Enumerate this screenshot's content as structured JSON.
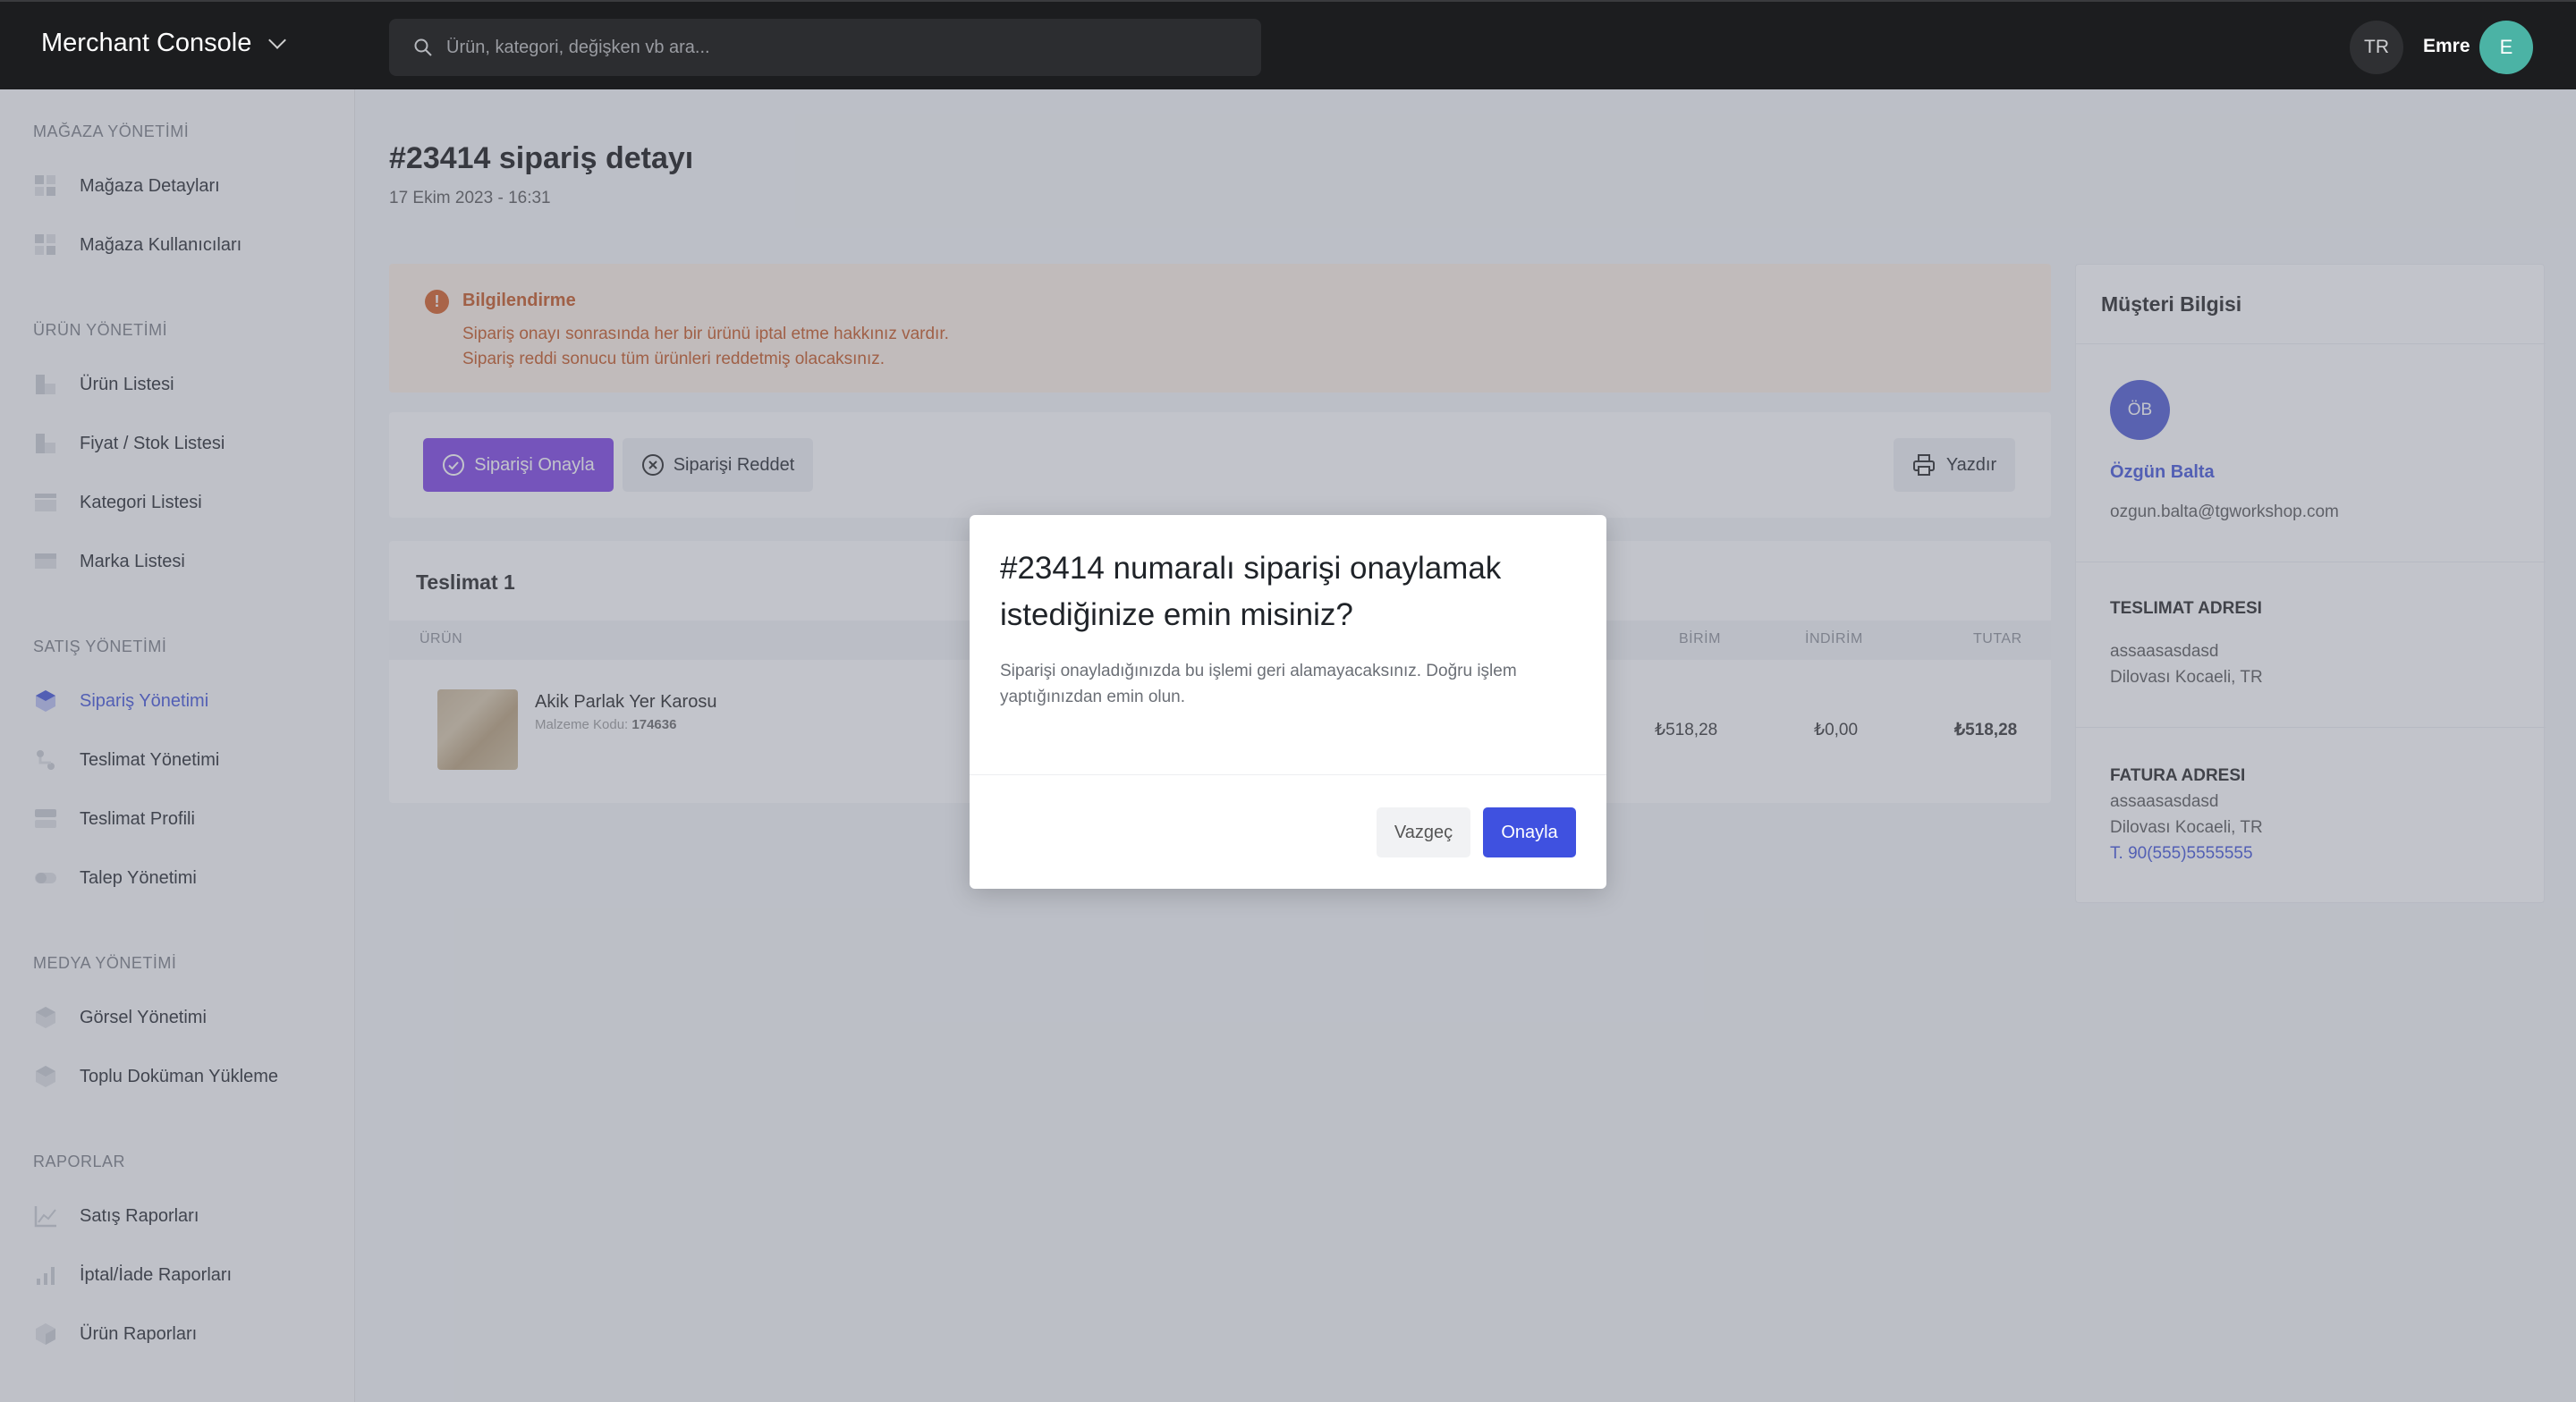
{
  "header": {
    "app_title": "Merchant Console",
    "search_placeholder": "Ürün, kategori, değişken vb ara...",
    "lang": "TR",
    "user_name": "Emre",
    "user_initial": "E"
  },
  "sidebar": {
    "sections": [
      {
        "title": "MAĞAZA YÖNETİMİ",
        "items": [
          {
            "label": "Mağaza Detayları",
            "icon": "grid-icon"
          },
          {
            "label": "Mağaza Kullanıcıları",
            "icon": "grid-icon"
          }
        ]
      },
      {
        "title": "ÜRÜN YÖNETİMİ",
        "items": [
          {
            "label": "Ürün Listesi",
            "icon": "product-icon"
          },
          {
            "label": "Fiyat / Stok Listesi",
            "icon": "product-icon"
          },
          {
            "label": "Kategori Listesi",
            "icon": "table-icon"
          },
          {
            "label": "Marka Listesi",
            "icon": "card-icon"
          }
        ]
      },
      {
        "title": "SATIŞ YÖNETİMİ",
        "items": [
          {
            "label": "Sipariş Yönetimi",
            "icon": "box-icon"
          },
          {
            "label": "Teslimat Yönetimi",
            "icon": "route-icon"
          },
          {
            "label": "Teslimat Profili",
            "icon": "server-icon"
          },
          {
            "label": "Talep Yönetimi",
            "icon": "toggle-icon"
          }
        ]
      },
      {
        "title": "MEDYA YÖNETİMİ",
        "items": [
          {
            "label": "Görsel Yönetimi",
            "icon": "box-icon"
          },
          {
            "label": "Toplu Doküman Yükleme",
            "icon": "box-icon"
          }
        ]
      },
      {
        "title": "RAPORLAR",
        "items": [
          {
            "label": "Satış Raporları",
            "icon": "line-chart-icon"
          },
          {
            "label": "İptal/İade Raporları",
            "icon": "bar-chart-icon"
          },
          {
            "label": "Ürün Raporları",
            "icon": "cube-icon"
          }
        ]
      }
    ],
    "active": "Sipariş Yönetimi"
  },
  "order": {
    "title": "#23414 sipariş detayı",
    "date": "17 Ekim 2023 - 16:31"
  },
  "alert": {
    "title": "Bilgilendirme",
    "line1": "Sipariş onayı sonrasında her bir ürünü iptal etme hakkınız vardır.",
    "line2": "Sipariş reddi sonucu tüm ürünleri reddetmiş olacaksınız."
  },
  "actions": {
    "approve": "Siparişi Onayla",
    "reject": "Siparişi Reddet",
    "print": "Yazdır"
  },
  "delivery": {
    "title": "Teslimat 1",
    "columns": {
      "product": "ÜRÜN",
      "unit": "BİRİM",
      "discount": "İNDİRİM",
      "total": "TUTAR"
    },
    "rows": [
      {
        "name": "Akik Parlak Yer Karosu",
        "code_label": "Malzeme Kodu:",
        "code": "174636",
        "unit": "₺518,28",
        "discount": "₺0,00",
        "total": "₺518,28"
      }
    ]
  },
  "customer": {
    "title": "Müşteri Bilgisi",
    "initials": "ÖB",
    "name": "Özgün Balta",
    "email": "ozgun.balta@tgworkshop.com",
    "shipping_label": "TESLIMAT ADRESI",
    "shipping_line1": "assaasasdasd",
    "shipping_line2": "Dilovası Kocaeli, TR",
    "billing_label": "FATURA ADRESI",
    "billing_line1": "assaasasdasd",
    "billing_line2": "Dilovası Kocaeli, TR",
    "phone_prefix": "T.",
    "phone": "90(555)5555555"
  },
  "modal": {
    "title": "#23414 numaralı siparişi onaylamak istediğinize emin misiniz?",
    "text": "Siparişi onayladığınızda bu işlemi geri alamayacaksınız. Doğru işlem yaptığınızdan emin olun.",
    "cancel": "Vazgeç",
    "confirm": "Onayla"
  },
  "colors": {
    "accent": "#3f51e0",
    "approve": "#7b3fe4",
    "alert_text": "#c4531c",
    "alert_bg": "#fdf0e4",
    "topbar": "#1c1d1f"
  }
}
